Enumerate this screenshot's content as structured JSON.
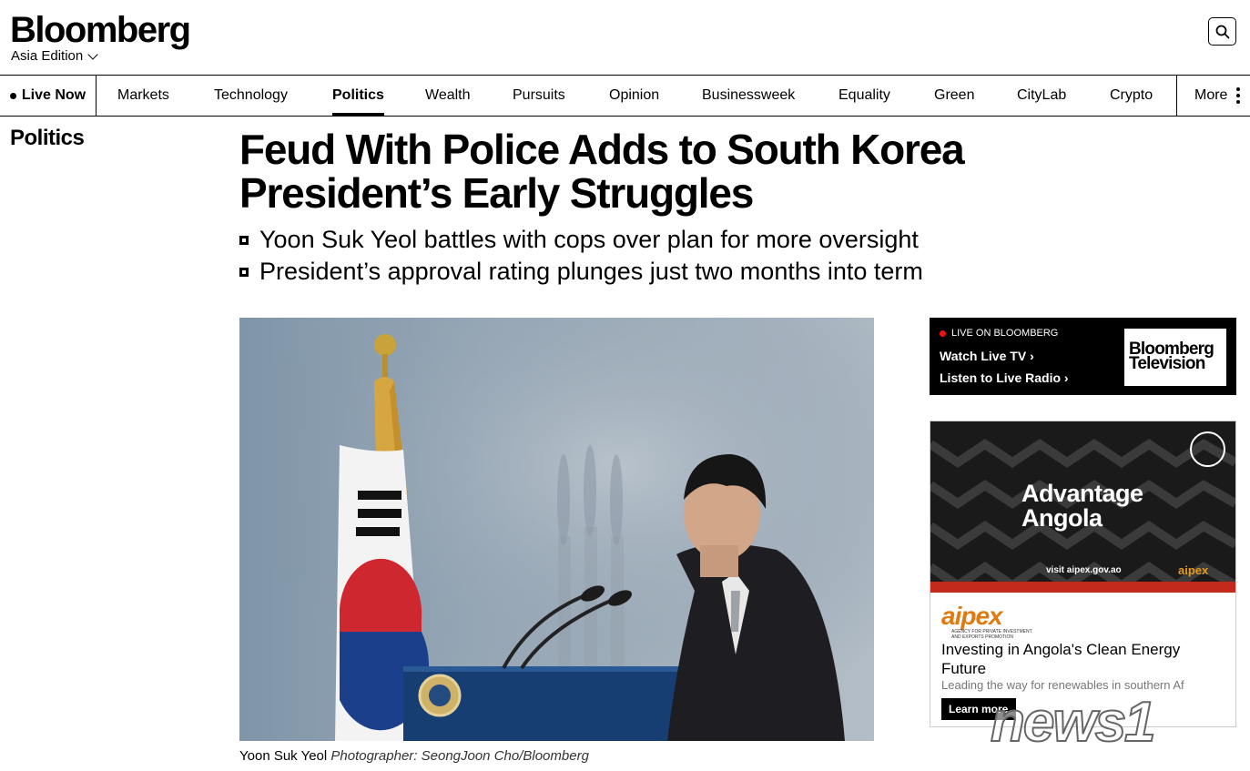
{
  "header": {
    "logo": "Bloomberg",
    "edition": "Asia Edition"
  },
  "nav": {
    "live": "Live Now",
    "items": [
      "Markets",
      "Technology",
      "Politics",
      "Wealth",
      "Pursuits",
      "Opinion",
      "Businessweek",
      "Equality",
      "Green",
      "CityLab",
      "Crypto"
    ],
    "active": "Politics",
    "more": "More"
  },
  "section": "Politics",
  "article": {
    "headline_line1": "Feud With Police Adds to South Korea",
    "headline_line2": "President’s Early Struggles",
    "bullets": [
      "Yoon Suk Yeol battles with cops over plan for more oversight",
      "President’s approval rating plunges just two months into term"
    ],
    "caption_subject": "Yoon Suk Yeol",
    "caption_credit": "Photographer: SeongJoon Cho/Bloomberg"
  },
  "live_box": {
    "label": "LIVE ON BLOOMBERG",
    "watch": "Watch Live TV",
    "listen": "Listen to Live Radio",
    "logo_line1": "Bloomberg",
    "logo_line2": "Television"
  },
  "ad": {
    "title_line1": "Advantage",
    "title_line2": "Angola",
    "visit": "visit aipex.gov.ao",
    "brand_small": "aipex",
    "logo": "aipex",
    "logo_sub_line1": "AGENCY FOR PRIVATE INVESTMENT",
    "logo_sub_line2": "AND EXPORTS PROMOTION",
    "headline": "Investing in Angola's Clean Energy Future",
    "description": "Leading the way for renewables in southern Af",
    "button": "Learn more"
  },
  "watermark": "news1",
  "colors": {
    "live_red": "#e11111",
    "ad_orange": "#e07a10"
  }
}
